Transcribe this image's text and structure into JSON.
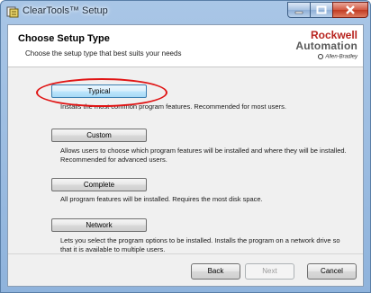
{
  "window": {
    "title": "ClearTools™ Setup"
  },
  "header": {
    "title": "Choose Setup Type",
    "subtitle": "Choose the setup type that best suits your needs",
    "brand_line1": "Rockwell",
    "brand_line2": "Automation",
    "brand_sub": "Allen-Bradley"
  },
  "options": [
    {
      "label": "Typical",
      "description": "Installs the most common program features. Recommended for most users.",
      "selected": true
    },
    {
      "label": "Custom",
      "description": "Allows users to choose which program features will be installed and where they will be installed. Recommended for advanced users.",
      "selected": false
    },
    {
      "label": "Complete",
      "description": "All program features will be installed. Requires the most disk space.",
      "selected": false
    },
    {
      "label": "Network",
      "description": "Lets you select the program options to be installed. Installs the program on a network drive so that it is available to multiple users.",
      "selected": false
    }
  ],
  "footer": {
    "back_label": "Back",
    "next_label": "Next",
    "cancel_label": "Cancel"
  },
  "colors": {
    "annotation_ellipse": "#e01515",
    "brand_red": "#b8241f"
  }
}
